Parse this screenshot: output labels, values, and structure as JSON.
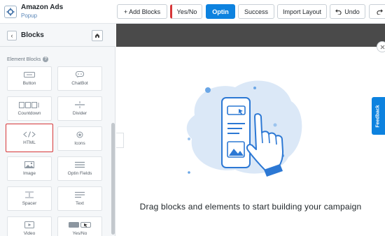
{
  "app": {
    "title": "Amazon Ads",
    "subtitle": "Popup",
    "gear_icon": "gear-icon"
  },
  "toolbar": {
    "add_blocks": "+ Add Blocks",
    "yes_no": "Yes/No",
    "optin": "Optin",
    "success": "Success",
    "import_layout": "Import Layout",
    "undo": "Undo",
    "undo_icon": "undo-icon",
    "redo_icon": "redo-icon",
    "active_color": "#0d82df",
    "marker_color": "#d63638"
  },
  "sidebar": {
    "title": "Blocks",
    "back_icon": "chevron-left-icon",
    "home_icon": "home-icon",
    "section_label": "Element Blocks",
    "help_icon": "?",
    "blocks": [
      {
        "label": "Button",
        "icon": "button-icon"
      },
      {
        "label": "ChatBot",
        "icon": "chatbot-icon"
      },
      {
        "label": "Countdown",
        "icon": "countdown-icon"
      },
      {
        "label": "Divider",
        "icon": "divider-icon"
      },
      {
        "label": "HTML",
        "icon": "html-code-icon"
      },
      {
        "label": "Icons",
        "icon": "icons-icon"
      },
      {
        "label": "Image",
        "icon": "image-icon"
      },
      {
        "label": "Optin Fields",
        "icon": "optin-fields-icon"
      },
      {
        "label": "Spacer",
        "icon": "spacer-icon"
      },
      {
        "label": "Text",
        "icon": "text-icon"
      },
      {
        "label": "Video",
        "icon": "video-icon"
      },
      {
        "label": "Yes/No",
        "icon": "yes-no-icon"
      }
    ]
  },
  "canvas": {
    "empty_message": "Drag blocks and elements to start building your campaign",
    "feedback": "Feedback",
    "collapse_icon": "chevron-left-icon",
    "close_icon": "close-icon"
  }
}
